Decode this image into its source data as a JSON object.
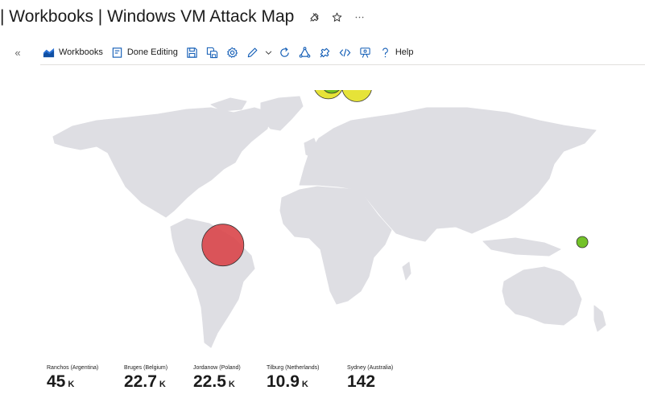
{
  "header": {
    "title": "| Workbooks | Windows VM Attack Map",
    "icons": [
      "pin-icon",
      "star-icon",
      "more-icon"
    ]
  },
  "toolbar": {
    "collapse_glyph": "«",
    "workbooks_label": "Workbooks",
    "done_editing_label": "Done Editing",
    "help_label": "Help",
    "icons": [
      "save-icon",
      "save-as-icon",
      "settings-icon",
      "edit-icon",
      "chevron-down-icon",
      "refresh-icon",
      "share-icon",
      "pin-icon",
      "code-icon",
      "feedback-icon",
      "help-icon"
    ]
  },
  "colors": {
    "land": "#dedee3",
    "high": "#d94549",
    "medium": "#e3e022",
    "low": "#6bbf1c",
    "toolbar_icon": "#0f5bb5"
  },
  "map": {
    "markers": [
      {
        "location": "Ranchos (Argentina)",
        "lat": -35.5,
        "lon": -58.3,
        "level": "high"
      },
      {
        "location": "Bruges (Belgium)",
        "lat": 51.2,
        "lon": 3.2,
        "level": "medium"
      },
      {
        "location": "Jordanow (Poland)",
        "lat": 49.7,
        "lon": 19.8,
        "level": "medium"
      },
      {
        "location": "Tilburg (Netherlands)",
        "lat": 51.6,
        "lon": 5.1,
        "level": "low"
      },
      {
        "location": "Sydney (Australia)",
        "lat": -33.9,
        "lon": 151.2,
        "level": "low"
      }
    ]
  },
  "tiles": [
    {
      "location": "Ranchos (Argentina)",
      "value": "45",
      "unit": "K"
    },
    {
      "location": "Bruges (Belgium)",
      "value": "22.7",
      "unit": "K"
    },
    {
      "location": "Jordanow (Poland)",
      "value": "22.5",
      "unit": "K"
    },
    {
      "location": "Tilburg (Netherlands)",
      "value": "10.9",
      "unit": "K"
    },
    {
      "location": "Sydney (Australia)",
      "value": "142",
      "unit": ""
    }
  ]
}
